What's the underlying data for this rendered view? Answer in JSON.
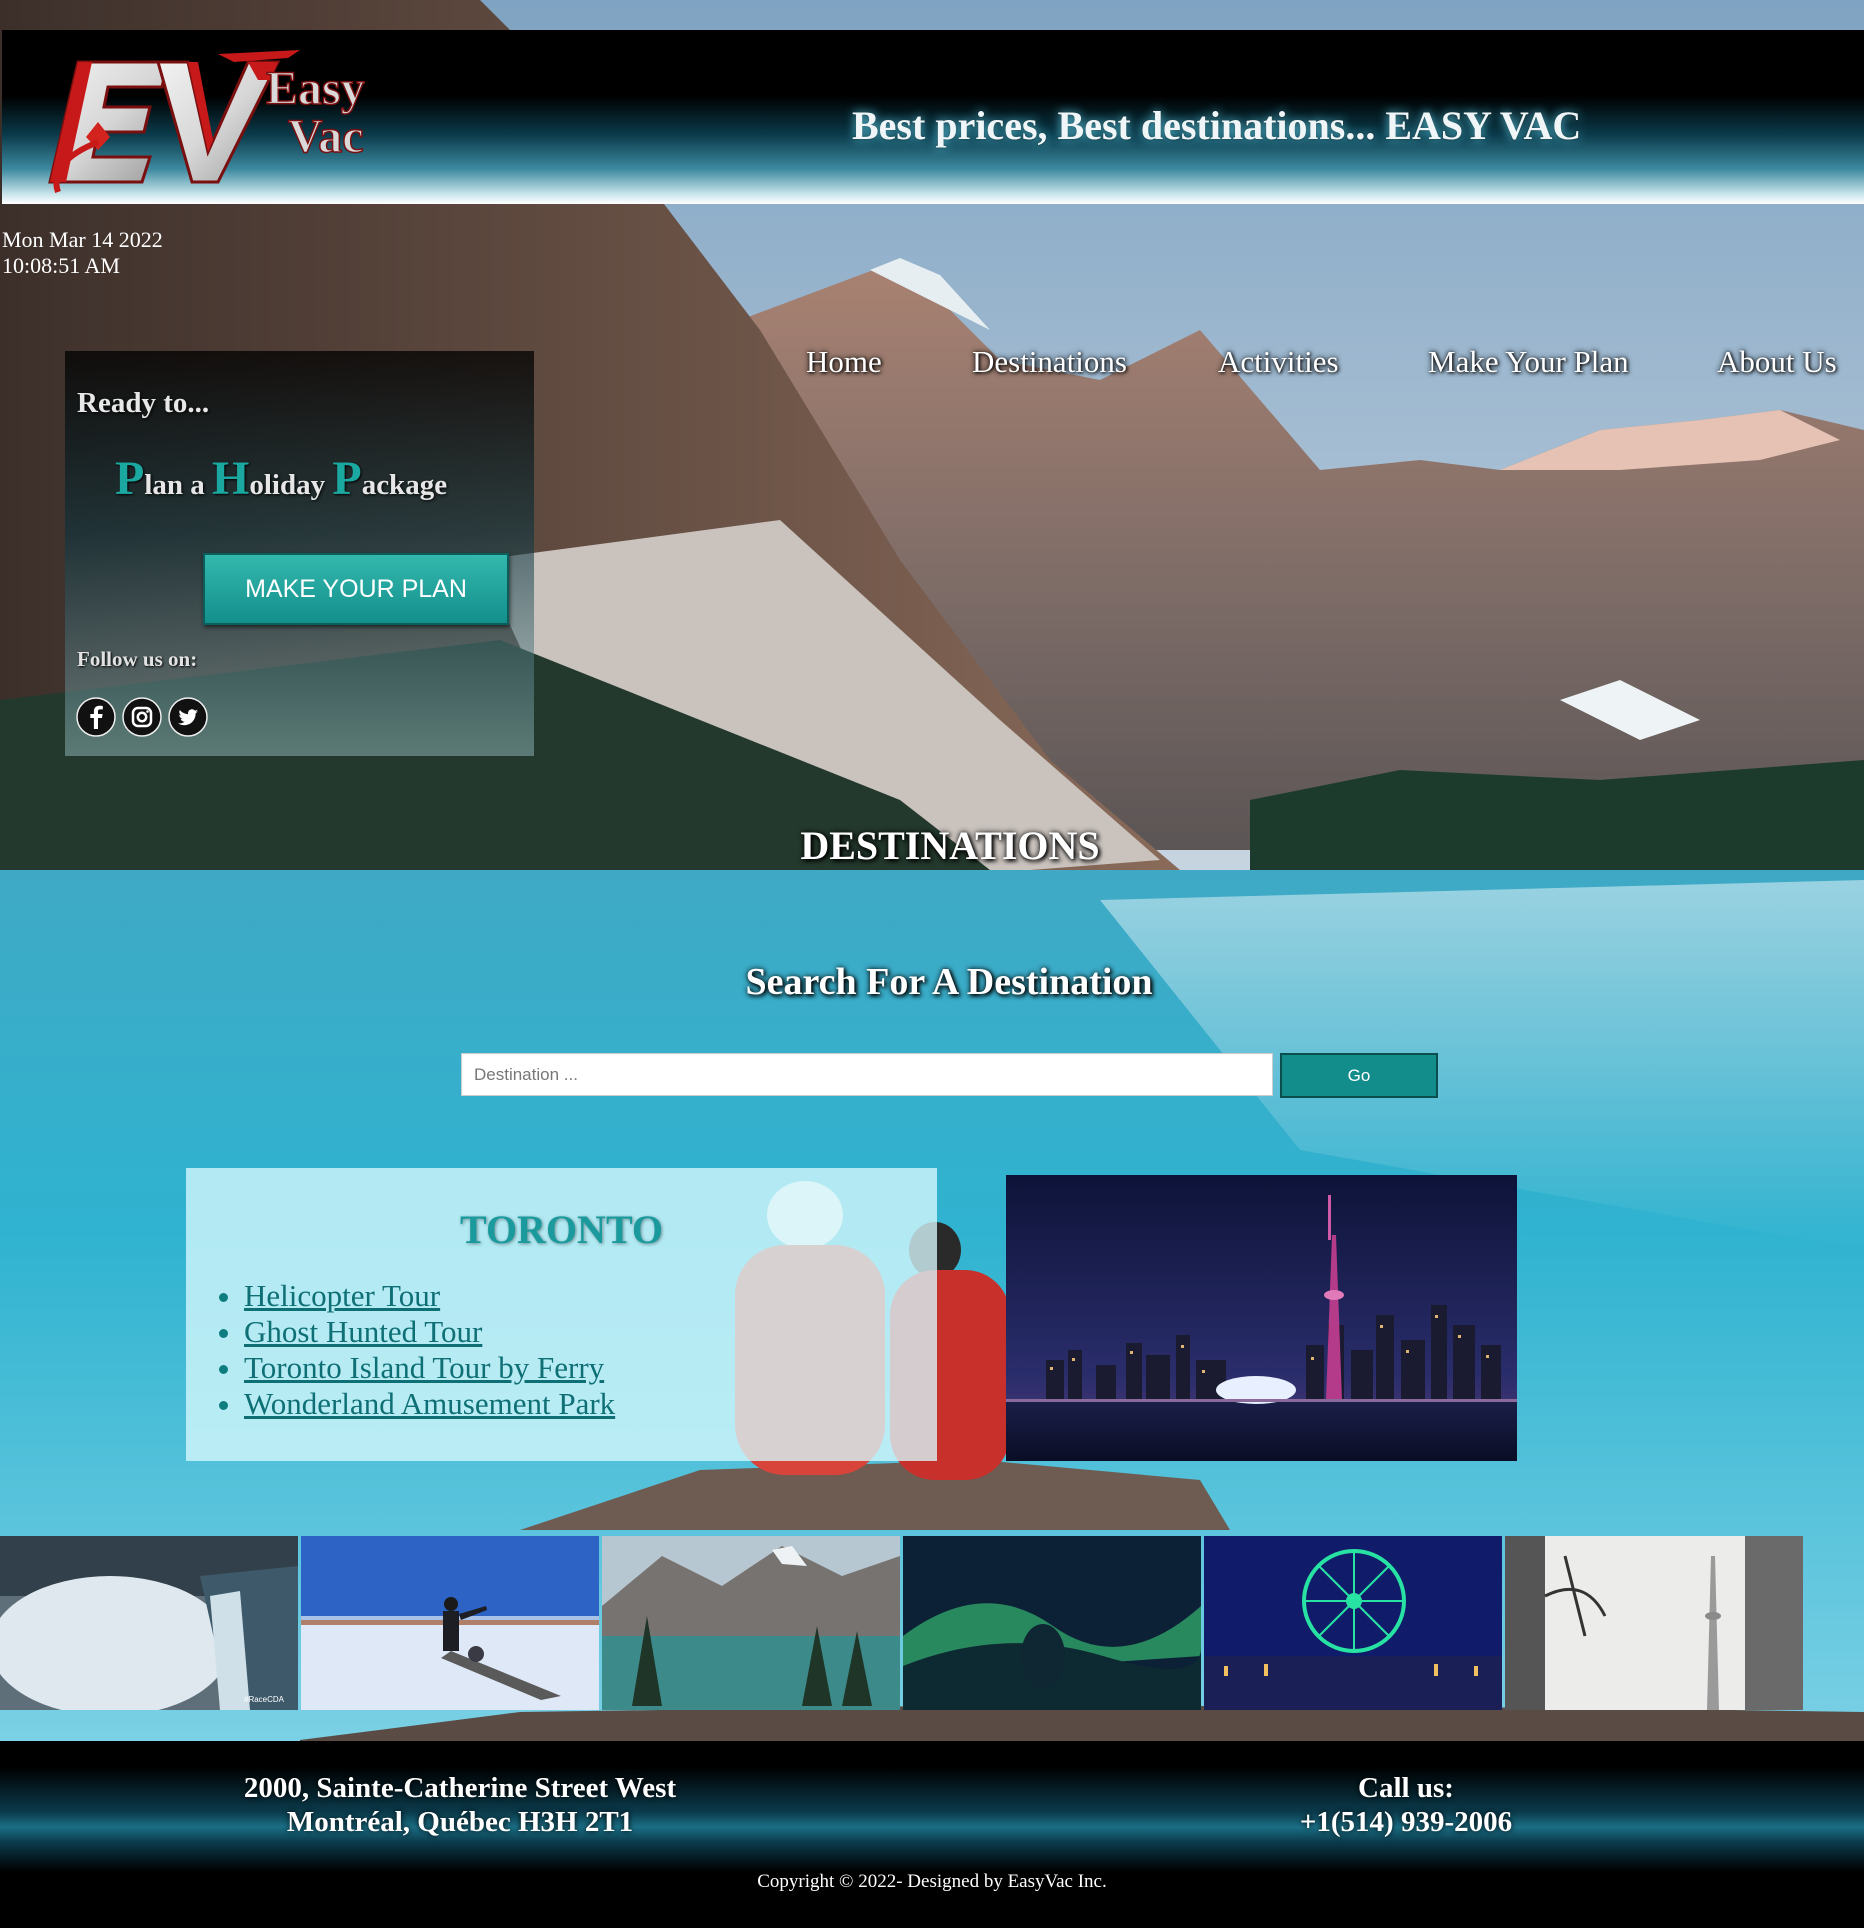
{
  "header": {
    "logo_letters": "EV",
    "logo_word1": "Easy",
    "logo_word2": "Vac",
    "tagline": "Best prices, Best destinations... EASY VAC"
  },
  "clock": {
    "date": "Mon Mar 14 2022",
    "time": "10:08:51 AM"
  },
  "nav": {
    "items": [
      {
        "label": "Home"
      },
      {
        "label": "Destinations"
      },
      {
        "label": "Activities"
      },
      {
        "label": "Make Your Plan"
      },
      {
        "label": "About Us"
      }
    ]
  },
  "promo": {
    "ready": "Ready to...",
    "php": {
      "c1": "P",
      "w1": "lan a",
      "c2": "H",
      "w2": "oliday",
      "c3": "P",
      "w3": "ackage"
    },
    "button_label": "MAKE YOUR PLAN",
    "follow_label": "Follow us on:",
    "socials": [
      "facebook-icon",
      "instagram-icon",
      "twitter-icon"
    ]
  },
  "destinations": {
    "title": "DESTINATIONS",
    "search_title": "Search For A Destination",
    "search_placeholder": "Destination ...",
    "go_label": "Go"
  },
  "card": {
    "city": "TORONTO",
    "activities": [
      "Helicopter Tour",
      "Ghost Hunted Tour",
      "Toronto Island Tour by Ferry",
      "Wonderland Amusement Park"
    ]
  },
  "gallery": {
    "tile1_caption": "#RaceCDA"
  },
  "footer": {
    "address_line1": "2000, Sainte-Catherine Street West",
    "address_line2": "Montréal, Québec H3H 2T1",
    "call_label": "Call us:",
    "phone": "+1(514) 939-2006",
    "copyright": "Copyright © 2022- Designed by EasyVac Inc."
  },
  "colors": {
    "accent_teal": "#138d8b",
    "link_teal": "#0e6f75",
    "header_black": "#000000",
    "glow": "#5fd0ea"
  }
}
